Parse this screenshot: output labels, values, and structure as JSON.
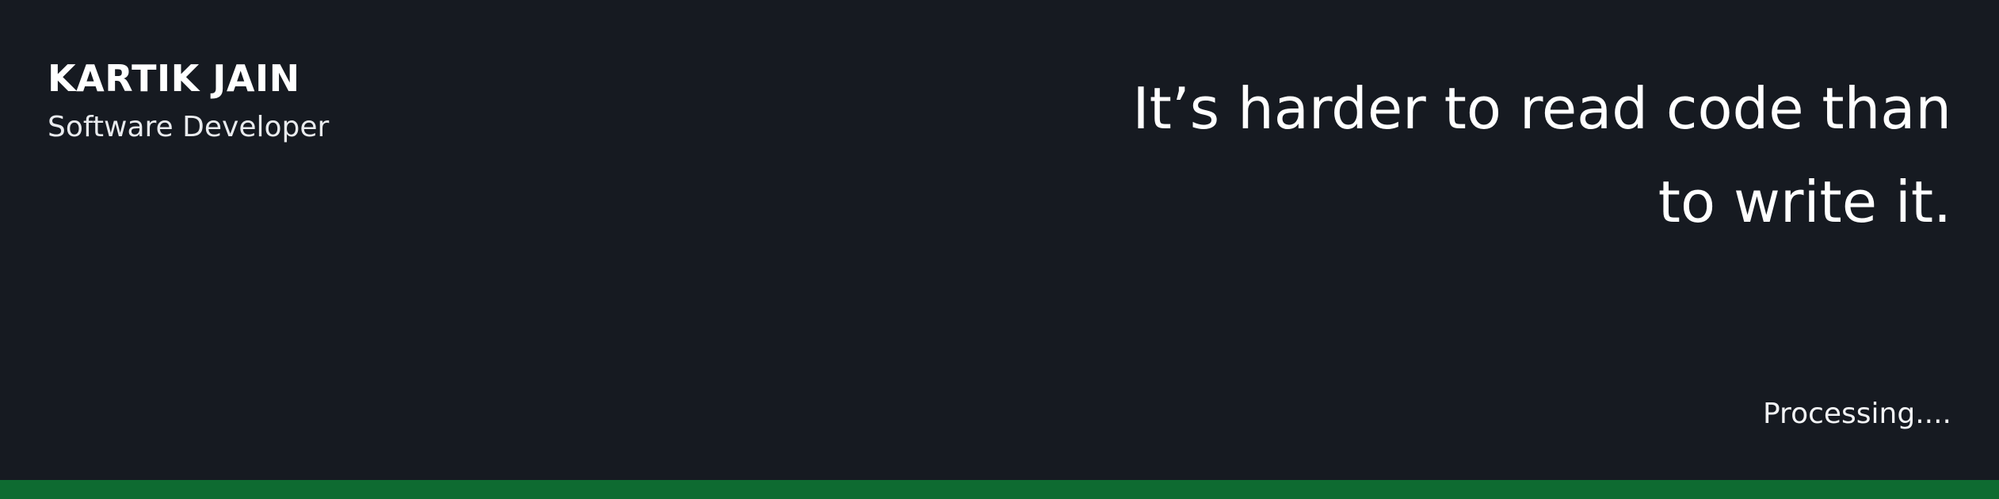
{
  "profile": {
    "name": "KARTIK JAIN",
    "role": "Software Developer"
  },
  "quote": {
    "line1": "It’s harder to read code than",
    "line2": "to write it."
  },
  "status": {
    "text": "Processing...."
  },
  "colors": {
    "background": "#161a21",
    "text": "#ffffff",
    "accent": "#0e6b31"
  }
}
